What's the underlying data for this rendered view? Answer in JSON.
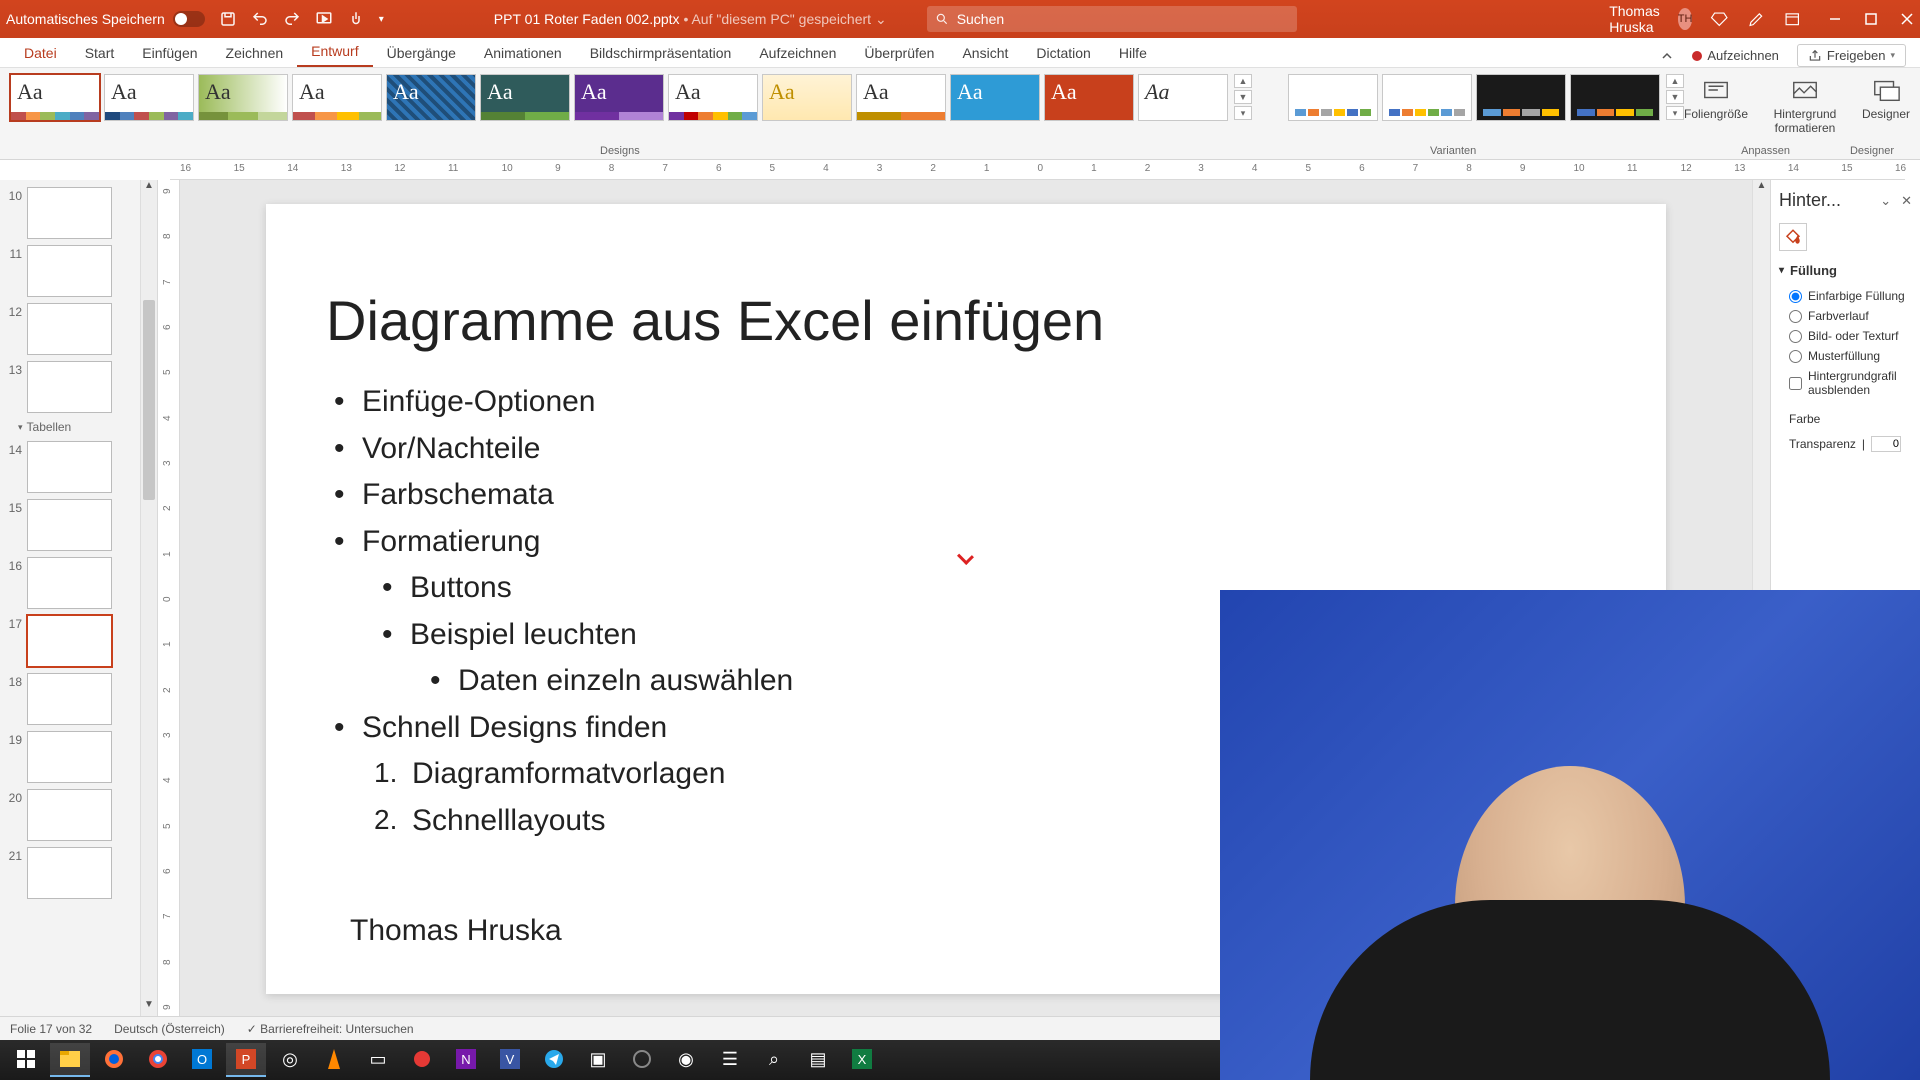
{
  "titlebar": {
    "autosave": "Automatisches Speichern",
    "filename": "PPT 01 Roter Faden 002.pptx",
    "saved_state": "Auf \"diesem PC\" gespeichert",
    "search_placeholder": "Suchen",
    "user_name": "Thomas Hruska",
    "user_initials": "TH"
  },
  "tabs": {
    "items": [
      "Datei",
      "Start",
      "Einfügen",
      "Zeichnen",
      "Entwurf",
      "Übergänge",
      "Animationen",
      "Bildschirmpräsentation",
      "Aufzeichnen",
      "Überprüfen",
      "Ansicht",
      "Dictation",
      "Hilfe"
    ],
    "active_index": 4,
    "record": "Aufzeichnen",
    "share": "Freigeben"
  },
  "ribbon": {
    "designs_label": "Designs",
    "variants_label": "Varianten",
    "anpassen_label": "Anpassen",
    "designer_label": "Designer",
    "foliengroesse": "Foliengröße",
    "hintergrund_formatieren": "Hintergrund formatieren",
    "designer_btn": "Designer"
  },
  "thumbs": {
    "section": "Tabellen",
    "nums": [
      "10",
      "11",
      "12",
      "13",
      "14",
      "15",
      "16",
      "17",
      "18",
      "19",
      "20",
      "21"
    ],
    "selected": "17"
  },
  "slide": {
    "title": "Diagramme aus Excel einfügen",
    "b1": "Einfüge-Optionen",
    "b2": "Vor/Nachteile",
    "b3": "Farbschemata",
    "b4": "Formatierung",
    "b4a": "Buttons",
    "b4b": "Beispiel leuchten",
    "b4b1": "Daten einzeln auswählen",
    "b5": "Schnell Designs finden",
    "b5_1": "Diagramformatvorlagen",
    "b5_2": "Schnelllayouts",
    "author": "Thomas Hruska"
  },
  "format_pane": {
    "title": "Hinter...",
    "section": "Füllung",
    "o1": "Einfarbige Füllung",
    "o2": "Farbverlauf",
    "o3": "Bild- oder Texturf",
    "o4": "Musterfüllung",
    "o5": "Hintergrundgrafil ausblenden",
    "farbe": "Farbe",
    "transparenz": "Transparenz",
    "transparenz_val": "0"
  },
  "status": {
    "slide_of": "Folie 17 von 32",
    "lang": "Deutsch (Österreich)",
    "access": "Barrierefreiheit: Untersuchen"
  },
  "ruler_ticks": [
    "16",
    "15",
    "14",
    "13",
    "12",
    "11",
    "10",
    "9",
    "8",
    "7",
    "6",
    "5",
    "4",
    "3",
    "2",
    "1",
    "0",
    "1",
    "2",
    "3",
    "4",
    "5",
    "6",
    "7",
    "8",
    "9",
    "10",
    "11",
    "12",
    "13",
    "14",
    "15",
    "16"
  ],
  "ruler_v": [
    "9",
    "8",
    "7",
    "6",
    "5",
    "4",
    "3",
    "2",
    "1",
    "0",
    "1",
    "2",
    "3",
    "4",
    "5",
    "6",
    "7",
    "8",
    "9"
  ]
}
